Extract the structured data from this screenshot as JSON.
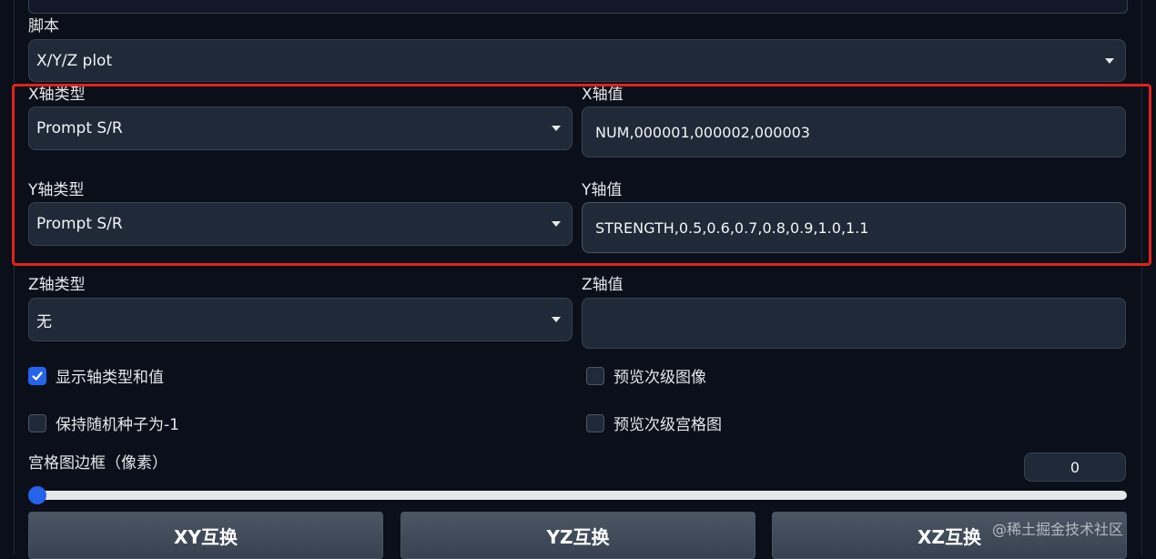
{
  "script": {
    "label": "脚本",
    "selected": "X/Y/Z plot"
  },
  "x_axis": {
    "type_label": "X轴类型",
    "type_value": "Prompt S/R",
    "values_label": "X轴值",
    "values": "NUM,000001,000002,000003"
  },
  "y_axis": {
    "type_label": "Y轴类型",
    "type_value": "Prompt S/R",
    "values_label": "Y轴值",
    "values": "STRENGTH,0.5,0.6,0.7,0.8,0.9,1.0,1.1"
  },
  "z_axis": {
    "type_label": "Z轴类型",
    "type_value": "无",
    "values_label": "Z轴值",
    "values": ""
  },
  "options": {
    "draw_legend": {
      "label": "显示轴类型和值",
      "checked": true
    },
    "preview_subgrid_images": {
      "label": "预览次级图像",
      "checked": false
    },
    "keep_random_seed": {
      "label": "保持随机种子为-1",
      "checked": false
    },
    "preview_subgrid_grid": {
      "label": "预览次级宫格图",
      "checked": false
    }
  },
  "grid_margin": {
    "label": "宫格图边框（像素）",
    "value": "0",
    "fraction": 0
  },
  "buttons": {
    "swap_xy": "XY互换",
    "swap_yz": "YZ互换",
    "swap_xz": "XZ互换"
  },
  "watermark": "@稀土掘金技术社区",
  "colors": {
    "background": "#0b0f19",
    "input_bg": "#1f2937",
    "accent": "#2563eb",
    "highlight_border": "#e0221c"
  }
}
